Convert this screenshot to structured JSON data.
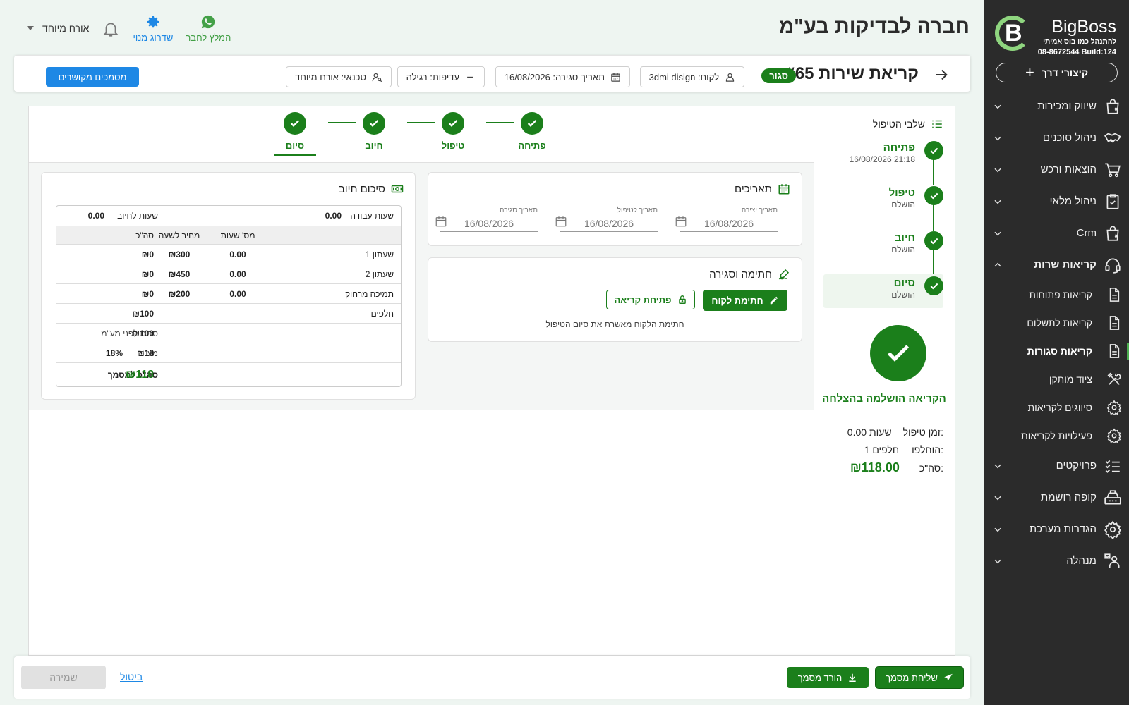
{
  "app": {
    "logo_name": "BigBoss",
    "logo_letter": "B",
    "tagline": "להתנהל כמו בוס אמיתי",
    "phone_build": "08-8672544  Build:124",
    "quick_actions": "קיצורי דרך",
    "brand_color": "#1b7f1b"
  },
  "sidebar": {
    "items": [
      {
        "label": "שיווק ומכירות",
        "icon": "bag-icon"
      },
      {
        "label": "ניהול סוכנים",
        "icon": "handshake-icon"
      },
      {
        "label": "הוצאות ורכש",
        "icon": "cart-icon"
      },
      {
        "label": "ניהול מלאי",
        "icon": "clipboard-icon"
      },
      {
        "label": "Crm",
        "icon": "bag-icon"
      },
      {
        "label": "קריאות שרות",
        "icon": "headset-icon"
      }
    ],
    "sub_items": [
      {
        "label": "קריאות פתוחות",
        "icon": "document-icon"
      },
      {
        "label": "קריאות לתשלום",
        "icon": "document-icon"
      },
      {
        "label": "קריאות סגורות",
        "icon": "document-icon"
      },
      {
        "label": "ציוד מותקן",
        "icon": "tools-icon"
      },
      {
        "label": "סיווגים לקריאות",
        "icon": "gear-icon"
      },
      {
        "label": "פעילויות לקריאות",
        "icon": "gear-icon"
      }
    ],
    "items_after": [
      {
        "label": "פרויקטים",
        "icon": "checklist-icon"
      },
      {
        "label": "קופה רושמת",
        "icon": "register-icon"
      },
      {
        "label": "הגדרות מערכת",
        "icon": "gear-icon"
      },
      {
        "label": "מנהלה",
        "icon": "admin-icon"
      }
    ]
  },
  "header": {
    "company": "חברה לבדיקות בע\"מ",
    "user": "אורח מיוחד",
    "upgrade": "שדרוג מנוי",
    "recommend": "המלץ לחבר"
  },
  "ticket": {
    "title": "קריאת שירות #65",
    "status": "סגור",
    "customer": "לקוח: 3dmi disign",
    "close_date": "תאריך סגירה: 16/08/2026",
    "priority": "עדיפות: רגילה",
    "technician": "טכנאי: אורח מיוחד",
    "related_docs": "מסמכים מקושרים"
  },
  "stages": {
    "title": "שלבי הטיפול",
    "list": [
      {
        "name": "פתיחה",
        "sub": "16/08/2026 21:18"
      },
      {
        "name": "טיפול",
        "sub": "הושלם"
      },
      {
        "name": "חיוב",
        "sub": "הושלם"
      },
      {
        "name": "סיום",
        "sub": "הושלם"
      }
    ],
    "success": "הקריאה הושלמה בהצלחה",
    "time_label": "זמן טיפול:",
    "time_value": "0.00 שעות",
    "parts_label": "הוחלפו:",
    "parts_value": "1 חלפים",
    "total_label": "סה\"כ:",
    "total_value": "₪118.00"
  },
  "stepper": [
    "פתיחה",
    "טיפול",
    "חיוב",
    "סיום"
  ],
  "dates": {
    "title": "תאריכים",
    "fields": [
      {
        "label": "תאריך יצירה",
        "value": "16/08/2026"
      },
      {
        "label": "תאריך לטיפול",
        "value": "16/08/2026"
      },
      {
        "label": "תאריך סגירה",
        "value": "16/08/2026"
      }
    ]
  },
  "signing": {
    "title": "חתימה וסגירה",
    "sign_button": "חתימת לקוח",
    "open_button": "פתיחת קריאה",
    "note": "חתימת הלקוח מאשרת את סיום הטיפול"
  },
  "billing": {
    "title": "סיכום חיוב",
    "work_hours_label": "שעות עבודה",
    "work_hours": "0.00",
    "billable_hours_label": "שעות לחיוב",
    "billable_hours": "0.00",
    "columns": {
      "hours": "מס' שעות",
      "price": "מחיר לשעה",
      "total": "סה\"כ"
    },
    "rows": [
      {
        "name": "שעתון 1",
        "hours": "0.00",
        "price": "₪300",
        "total": "₪0"
      },
      {
        "name": "שעתון 2",
        "hours": "0.00",
        "price": "₪450",
        "total": "₪0"
      },
      {
        "name": "תמיכה מרחוק",
        "hours": "0.00",
        "price": "₪200",
        "total": "₪0"
      }
    ],
    "parts_label": "חלפים",
    "parts_total": "₪100",
    "pre_vat_label": "סכום לפני מע\"מ",
    "pre_vat": "₪100",
    "vat_label": "מע\"מ",
    "vat_rate": "18%",
    "vat": "₪18",
    "doc_total_label": "סה\"כ למסמך",
    "doc_total": "₪118"
  },
  "footer": {
    "send": "שליחת מסמך",
    "download": "הורד מסמך",
    "cancel": "ביטול",
    "save": "שמירה"
  }
}
